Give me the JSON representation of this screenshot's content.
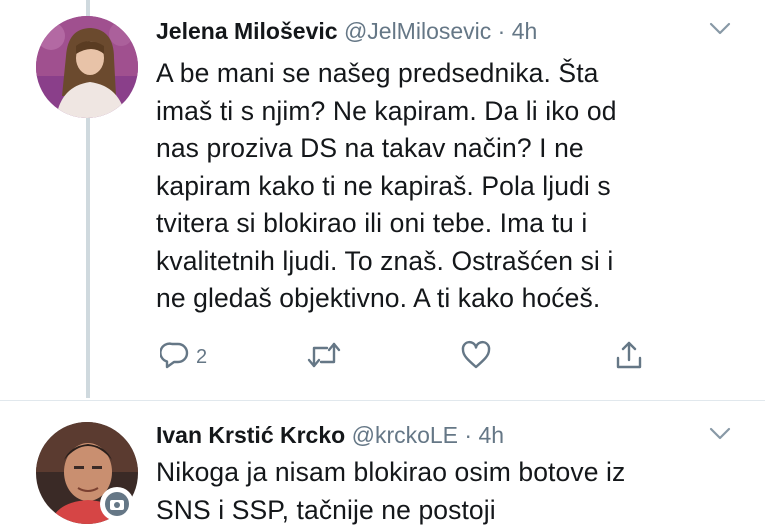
{
  "tweets": [
    {
      "author_name": "Jelena Miloševic",
      "handle": "@JelMilosevic",
      "separator": "·",
      "time": "4h",
      "lines": [
        "A be mani se našeg predsednika. Šta",
        "imaš ti s njim? Ne kapiram. Da li iko od",
        "nas proziva DS na takav način? I ne",
        "kapiram kako ti ne kapiraš. Pola ljudi s",
        "tvitera si blokirao ili oni tebe. Ima tu i",
        "kvalitetnih ljudi. To znaš. Ostrašćen si i",
        "ne gledaš objektivno. A ti kako hoćeš."
      ],
      "reply_count": "2",
      "icons": {
        "reply": "reply-icon",
        "retweet": "retweet-icon",
        "like": "like-icon",
        "share": "share-icon",
        "menu": "chevron-down-icon"
      }
    },
    {
      "author_name": "Ivan Krstić Krcko",
      "handle": "@krckoLE",
      "separator": "·",
      "time": "4h",
      "lines": [
        "Nikoga ja nisam blokirao osim botove iz",
        "SNS i SSP, tačnije ne postoji"
      ],
      "icons": {
        "menu": "chevron-down-icon",
        "badge": "camera-icon"
      }
    }
  ],
  "colors": {
    "text": "#14171a",
    "secondary": "#657786",
    "thread_line": "#cfd9de"
  }
}
